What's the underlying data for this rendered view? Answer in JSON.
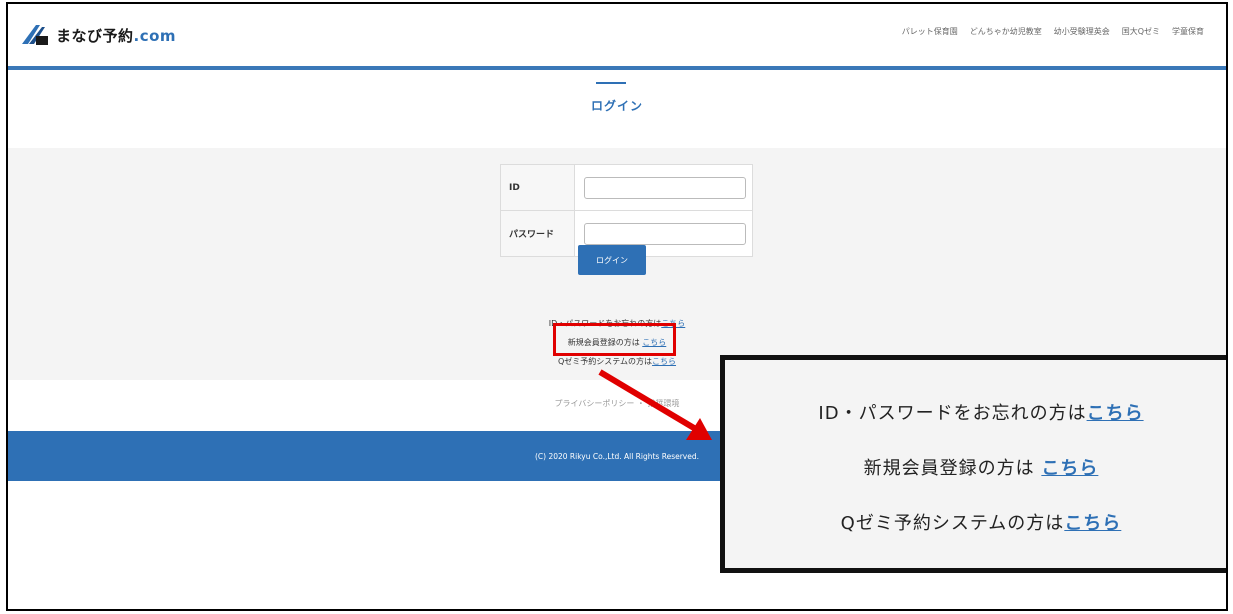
{
  "header": {
    "logo_text": "まなび予約",
    "logo_suffix": ".com",
    "nav": [
      "パレット保育園",
      "どんちゃか幼児教室",
      "幼小受験理英会",
      "国大Qゼミ",
      "学童保育"
    ]
  },
  "main": {
    "title": "ログイン",
    "form": {
      "id_label": "ID",
      "password_label": "パスワード",
      "id_value": "",
      "password_value": "",
      "submit_label": "ログイン"
    },
    "links": [
      {
        "prefix": "ID・パスワードをお忘れの方は",
        "link": "こちら"
      },
      {
        "prefix": "新規会員登録の方は ",
        "link": "こちら"
      },
      {
        "prefix": "Qゼミ予約システムの方は",
        "link": "こちら"
      }
    ]
  },
  "footer": {
    "privacy": "プライバシーポリシー",
    "separator": "・",
    "env": "推奨環境",
    "copyright": "(C) 2020 Rikyu Co.,Ltd. All Rights Reserved."
  },
  "colors": {
    "brand_blue": "#2e70b5",
    "highlight_red": "#e00000"
  }
}
